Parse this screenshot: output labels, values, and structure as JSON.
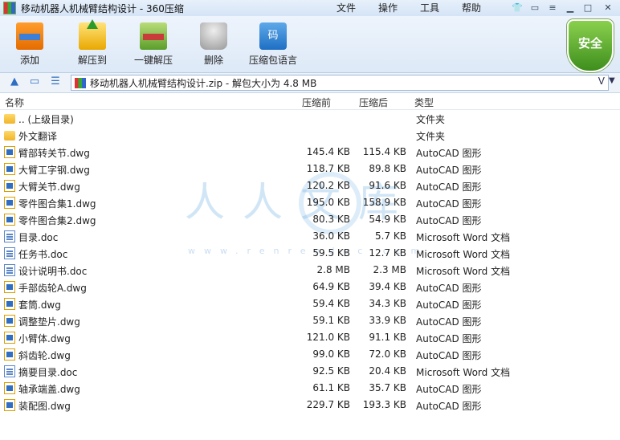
{
  "window": {
    "title": "移动机器人机械臂结构设计 - 360压缩",
    "menu": [
      "文件",
      "操作",
      "工具",
      "帮助"
    ]
  },
  "toolbar": {
    "add": "添加",
    "extract_to": "解压到",
    "one_key_extract": "一键解压",
    "delete": "删除",
    "archive_encoding": "压缩包语言"
  },
  "security_badge": "安全",
  "address": {
    "text": "移动机器人机械臂结构设计.zip - 解包大小为 4.8 MB"
  },
  "columns": {
    "name": "名称",
    "size": "压缩前",
    "packed": "压缩后",
    "type": "类型"
  },
  "watermark": {
    "text": "人人文库",
    "url": "www.renrendoc.com"
  },
  "files": [
    {
      "name": ".. (上级目录)",
      "size": "",
      "packed": "",
      "type": "文件夹",
      "icon": "folder-icon"
    },
    {
      "name": "外文翻译",
      "size": "",
      "packed": "",
      "type": "文件夹",
      "icon": "folder-icon"
    },
    {
      "name": "臂部转关节.dwg",
      "size": "145.4 KB",
      "packed": "115.4 KB",
      "type": "AutoCAD 图形",
      "icon": "dwg-file-icon"
    },
    {
      "name": "大臂工字钢.dwg",
      "size": "118.7 KB",
      "packed": "89.8 KB",
      "type": "AutoCAD 图形",
      "icon": "dwg-file-icon"
    },
    {
      "name": "大臂关节.dwg",
      "size": "120.2 KB",
      "packed": "91.6 KB",
      "type": "AutoCAD 图形",
      "icon": "dwg-file-icon"
    },
    {
      "name": "零件图合集1.dwg",
      "size": "195.0 KB",
      "packed": "158.9 KB",
      "type": "AutoCAD 图形",
      "icon": "dwg-file-icon"
    },
    {
      "name": "零件图合集2.dwg",
      "size": "80.3 KB",
      "packed": "54.9 KB",
      "type": "AutoCAD 图形",
      "icon": "dwg-file-icon"
    },
    {
      "name": "目录.doc",
      "size": "36.0 KB",
      "packed": "5.7 KB",
      "type": "Microsoft Word 文档",
      "icon": "doc-file-icon"
    },
    {
      "name": "任务书.doc",
      "size": "59.5 KB",
      "packed": "12.7 KB",
      "type": "Microsoft Word 文档",
      "icon": "doc-file-icon"
    },
    {
      "name": "设计说明书.doc",
      "size": "2.8 MB",
      "packed": "2.3 MB",
      "type": "Microsoft Word 文档",
      "icon": "doc-file-icon"
    },
    {
      "name": "手部齿轮A.dwg",
      "size": "64.9 KB",
      "packed": "39.4 KB",
      "type": "AutoCAD 图形",
      "icon": "dwg-file-icon"
    },
    {
      "name": "套筒.dwg",
      "size": "59.4 KB",
      "packed": "34.3 KB",
      "type": "AutoCAD 图形",
      "icon": "dwg-file-icon"
    },
    {
      "name": "调整垫片.dwg",
      "size": "59.1 KB",
      "packed": "33.9 KB",
      "type": "AutoCAD 图形",
      "icon": "dwg-file-icon"
    },
    {
      "name": "小臂体.dwg",
      "size": "121.0 KB",
      "packed": "91.1 KB",
      "type": "AutoCAD 图形",
      "icon": "dwg-file-icon"
    },
    {
      "name": "斜齿轮.dwg",
      "size": "99.0 KB",
      "packed": "72.0 KB",
      "type": "AutoCAD 图形",
      "icon": "dwg-file-icon"
    },
    {
      "name": "摘要目录.doc",
      "size": "92.5 KB",
      "packed": "20.4 KB",
      "type": "Microsoft Word 文档",
      "icon": "doc-file-icon"
    },
    {
      "name": "轴承端盖.dwg",
      "size": "61.1 KB",
      "packed": "35.7 KB",
      "type": "AutoCAD 图形",
      "icon": "dwg-file-icon"
    },
    {
      "name": "装配图.dwg",
      "size": "229.7 KB",
      "packed": "193.3 KB",
      "type": "AutoCAD 图形",
      "icon": "dwg-file-icon"
    }
  ]
}
